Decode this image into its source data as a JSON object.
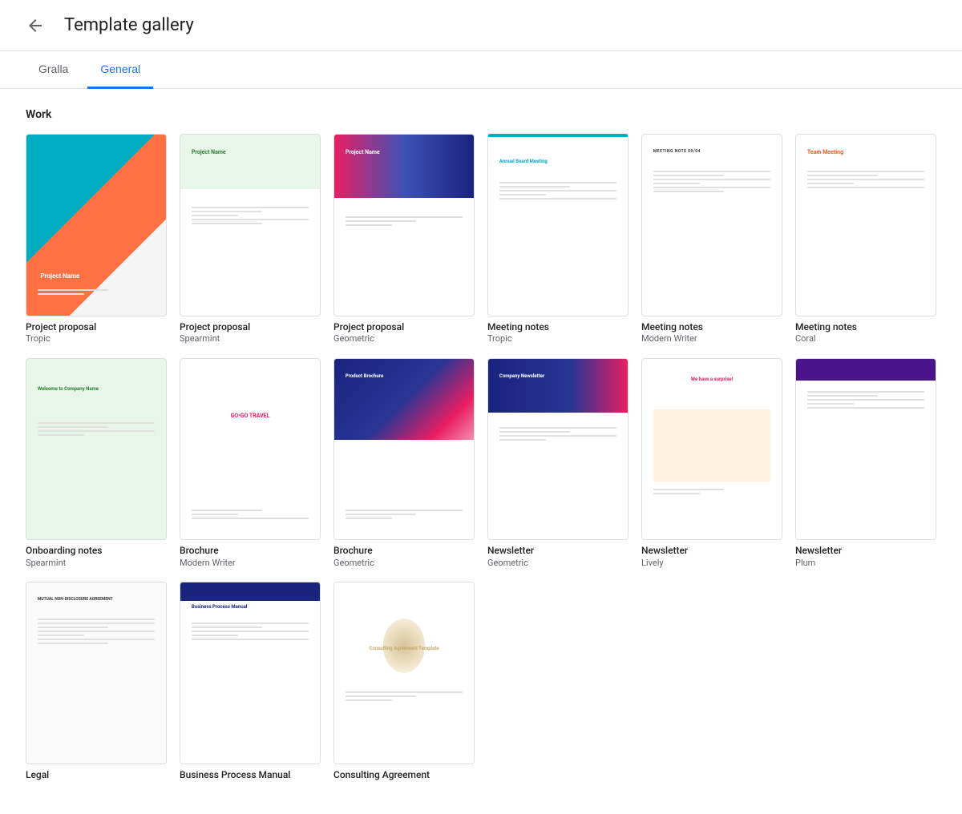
{
  "header": {
    "back_label": "Back",
    "title": "Template gallery"
  },
  "tabs": [
    {
      "id": "gralla",
      "label": "Gralla",
      "active": false
    },
    {
      "id": "general",
      "label": "General",
      "active": true
    }
  ],
  "sections": [
    {
      "id": "work",
      "label": "Work",
      "rows": [
        {
          "id": "row1",
          "templates": [
            {
              "id": "proj-tropic",
              "name": "Project proposal",
              "sub": "Tropic",
              "thumb_class": "thumb-proj-tropic"
            },
            {
              "id": "proj-spearmint",
              "name": "Project proposal",
              "sub": "Spearmint",
              "thumb_class": "thumb-proj-spearmint"
            },
            {
              "id": "proj-geo",
              "name": "Project proposal",
              "sub": "Geometric",
              "thumb_class": "thumb-proj-geometric"
            },
            {
              "id": "meet-tropic",
              "name": "Meeting notes",
              "sub": "Tropic",
              "thumb_class": "thumb-meet-tropic"
            },
            {
              "id": "meet-modern",
              "name": "Meeting notes",
              "sub": "Modern Writer",
              "thumb_class": "thumb-meet-modern"
            },
            {
              "id": "meet-coral",
              "name": "Meeting notes",
              "sub": "Coral",
              "thumb_class": "thumb-meet-coral"
            }
          ]
        },
        {
          "id": "row2",
          "templates": [
            {
              "id": "onboard",
              "name": "Onboarding notes",
              "sub": "Spearmint",
              "thumb_class": "thumb-onboard"
            },
            {
              "id": "brochure-modern",
              "name": "Brochure",
              "sub": "Modern Writer",
              "thumb_class": "thumb-brochure-modern"
            },
            {
              "id": "brochure-geo",
              "name": "Brochure",
              "sub": "Geometric",
              "thumb_class": "thumb-brochure-geo"
            },
            {
              "id": "news-geo",
              "name": "Newsletter",
              "sub": "Geometric",
              "thumb_class": "thumb-news-geo"
            },
            {
              "id": "news-lively",
              "name": "Newsletter",
              "sub": "Lively",
              "thumb_class": "thumb-news-lively"
            },
            {
              "id": "news-plum",
              "name": "Newsletter",
              "sub": "Plum",
              "thumb_class": "thumb-news-plum"
            }
          ]
        },
        {
          "id": "row3",
          "templates": [
            {
              "id": "legal",
              "name": "Legal",
              "sub": "",
              "thumb_class": "thumb-legal"
            },
            {
              "id": "business-manual",
              "name": "Business Process Manual",
              "sub": "",
              "thumb_class": "thumb-business"
            },
            {
              "id": "consulting",
              "name": "Consulting Agreement",
              "sub": "",
              "thumb_class": "thumb-consulting"
            }
          ]
        }
      ]
    }
  ]
}
